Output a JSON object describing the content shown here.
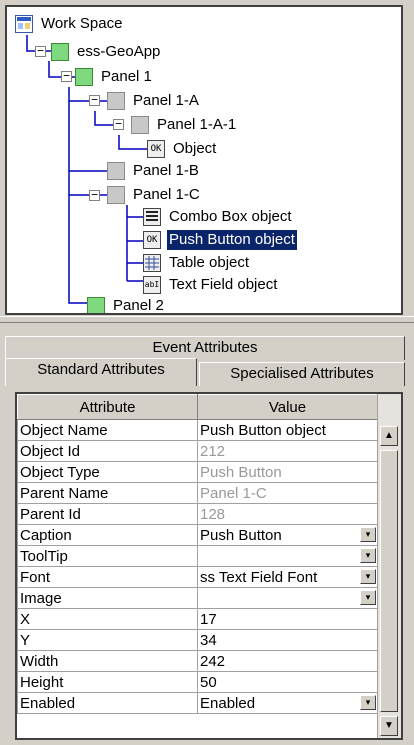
{
  "tree": {
    "root": {
      "label": "Work Space",
      "icon": "workspace-icon"
    },
    "nodes": [
      {
        "label": "ess-GeoApp",
        "icon": "green-panel-icon"
      },
      {
        "label": "Panel 1",
        "icon": "green-panel-icon"
      },
      {
        "label": "Panel 1-A",
        "icon": "gray-panel-icon"
      },
      {
        "label": "Panel 1-A-1",
        "icon": "gray-panel-icon"
      },
      {
        "label": "Object",
        "icon": "ok-button-icon"
      },
      {
        "label": "Panel 1-B",
        "icon": "gray-panel-icon"
      },
      {
        "label": "Panel 1-C",
        "icon": "gray-panel-icon"
      },
      {
        "label": "Combo Box object",
        "icon": "combo-box-icon"
      },
      {
        "label": "Push Button object",
        "icon": "push-button-icon",
        "selected": true
      },
      {
        "label": "Table object",
        "icon": "table-icon"
      },
      {
        "label": "Text Field object",
        "icon": "text-field-icon"
      },
      {
        "label": "Panel 2",
        "icon": "green-panel-icon"
      }
    ],
    "selection_color": "#0a246a"
  },
  "tabs": {
    "event": "Event Attributes",
    "standard": "Standard Attributes",
    "specialised": "Specialised Attributes",
    "active": "standard"
  },
  "table": {
    "headers": {
      "attribute": "Attribute",
      "value": "Value"
    },
    "rows": [
      {
        "attr": "Object Name",
        "value": "Push Button object",
        "readonly": false,
        "dropdown": false
      },
      {
        "attr": "Object Id",
        "value": "212",
        "readonly": true,
        "dropdown": false
      },
      {
        "attr": "Object Type",
        "value": "Push Button",
        "readonly": true,
        "dropdown": false
      },
      {
        "attr": "Parent Name",
        "value": "Panel 1-C",
        "readonly": true,
        "dropdown": false
      },
      {
        "attr": "Parent Id",
        "value": "128",
        "readonly": true,
        "dropdown": false
      },
      {
        "attr": "Caption",
        "value": "Push Button",
        "readonly": false,
        "dropdown": true
      },
      {
        "attr": "ToolTip",
        "value": "",
        "readonly": false,
        "dropdown": true
      },
      {
        "attr": "Font",
        "value": "ss Text Field Font",
        "readonly": false,
        "dropdown": true
      },
      {
        "attr": "Image",
        "value": "",
        "readonly": false,
        "dropdown": true
      },
      {
        "attr": "X",
        "value": "17",
        "readonly": false,
        "dropdown": false
      },
      {
        "attr": "Y",
        "value": "34",
        "readonly": false,
        "dropdown": false
      },
      {
        "attr": "Width",
        "value": "242",
        "readonly": false,
        "dropdown": false
      },
      {
        "attr": "Height",
        "value": "50",
        "readonly": false,
        "dropdown": false
      },
      {
        "attr": "Enabled",
        "value": "Enabled",
        "readonly": false,
        "dropdown": true
      }
    ]
  }
}
